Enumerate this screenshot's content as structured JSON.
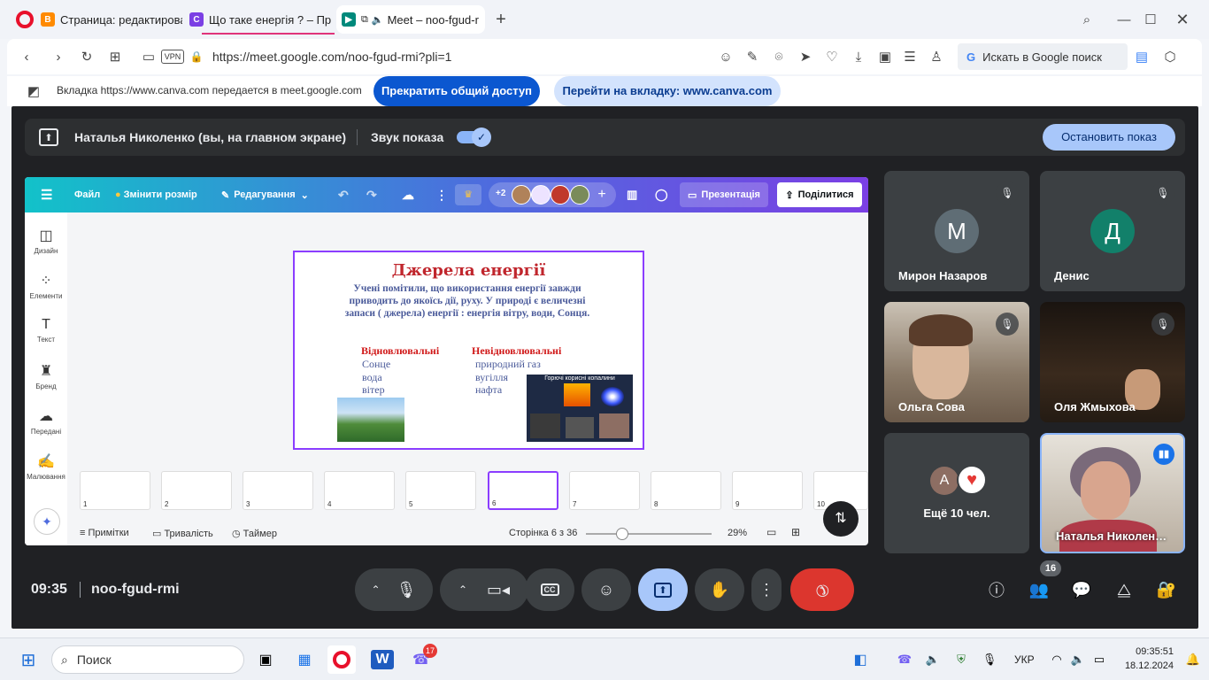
{
  "browser": {
    "tabs": [
      {
        "label": "Страница: редактирован"
      },
      {
        "label": "Що таке енергія ? – През"
      },
      {
        "label": "Meet – noo-fgud-r"
      }
    ],
    "url": "https://meet.google.com/noo-fgud-rmi?pli=1",
    "vpn": "VPN",
    "search_label": "Искать в Google поиск"
  },
  "share_banner": {
    "text": "Вкладка https://www.canva.com передается в meet.google.com",
    "stop_button": "Прекратить общий доступ",
    "goto_button": "Перейти на вкладку: www.canva.com"
  },
  "meet": {
    "presenter_text": "Наталья Николенко (вы, на главном экране)",
    "sound_label": "Звук показа",
    "stop_show_button": "Остановить показ",
    "time": "09:35",
    "meeting_code": "noo-fgud-rmi",
    "participants_count": "16",
    "participants": [
      {
        "name": "Мирон Назаров",
        "initial": "М",
        "color": "#5f6d75"
      },
      {
        "name": "Денис",
        "initial": "Д",
        "color": "#12806a"
      },
      {
        "name": "Ольга Сова"
      },
      {
        "name": "Оля Жмыхова"
      },
      {
        "name": "Ещё 10 чел.",
        "initial": "А",
        "color": "#8d6e63"
      },
      {
        "name": "Наталья Николен…"
      }
    ]
  },
  "canva": {
    "menu": {
      "file": "Файл",
      "resize": "Змінити розмір",
      "edit": "Редагування",
      "present": "Презентація",
      "share": "Поділитися",
      "collab_count": "+2"
    },
    "sidebar": [
      {
        "label": "Дизайн"
      },
      {
        "label": "Елементи"
      },
      {
        "label": "Текст"
      },
      {
        "label": "Бренд"
      },
      {
        "label": "Передані"
      },
      {
        "label": "Малювання"
      }
    ],
    "slide": {
      "title": "Джерела енергії",
      "body": "Учені помітили, що використання енергії завжди приводить до якоїсь дії, руху. У природі є величезні запаси ( джерела) енергії : енергія вітру, води, Сонця.",
      "renewable_head": "Відновлювальні",
      "renewable": [
        "Сонце",
        "вода",
        "вітер"
      ],
      "nonrenewable_head": "Невідновлювальні",
      "nonrenewable": [
        "природний газ",
        "вугілля",
        "нафта"
      ],
      "image_caption": "Горючі корисні копалини"
    },
    "thumbs": [
      "1",
      "2",
      "3",
      "4",
      "5",
      "6",
      "7",
      "8",
      "9",
      "10"
    ],
    "bottom": {
      "notes": "Примітки",
      "duration": "Тривалість",
      "timer": "Таймер",
      "page": "Сторінка 6 з 36",
      "zoom": "29%"
    }
  },
  "taskbar": {
    "search": "Поиск",
    "lang": "УКР",
    "time": "09:35:51",
    "date": "18.12.2024",
    "viber_badge": "17"
  }
}
